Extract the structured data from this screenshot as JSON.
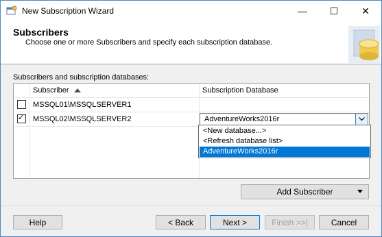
{
  "window": {
    "title": "New Subscription Wizard",
    "controls": {
      "minimize": "—",
      "maximize": "☐",
      "close": "✕"
    }
  },
  "header": {
    "title": "Subscribers",
    "subtitle": "Choose one or more Subscribers and specify each subscription database."
  },
  "grid": {
    "label": "Subscribers and subscription databases:",
    "columns": {
      "subscriber": "Subscriber",
      "database": "Subscription Database"
    },
    "sort": "ascending",
    "rows": [
      {
        "checked": false,
        "subscriber": "MSSQL01\\MSSQLSERVER1",
        "database": ""
      },
      {
        "checked": true,
        "subscriber": "MSSQL02\\MSSQLSERVER2",
        "database": "AdventureWorks2016r"
      }
    ],
    "check_mark": "✓"
  },
  "dropdown": {
    "options": [
      "<New database...>",
      "<Refresh database list>",
      "AdventureWorks2016r"
    ],
    "selected_index": 2
  },
  "buttons": {
    "add_subscriber": "Add Subscriber",
    "help": "Help",
    "back": "< Back",
    "next": "Next >",
    "finish": "Finish >>|",
    "cancel": "Cancel"
  },
  "colors": {
    "selection": "#0078d7",
    "border_accent": "#4a86c7"
  }
}
